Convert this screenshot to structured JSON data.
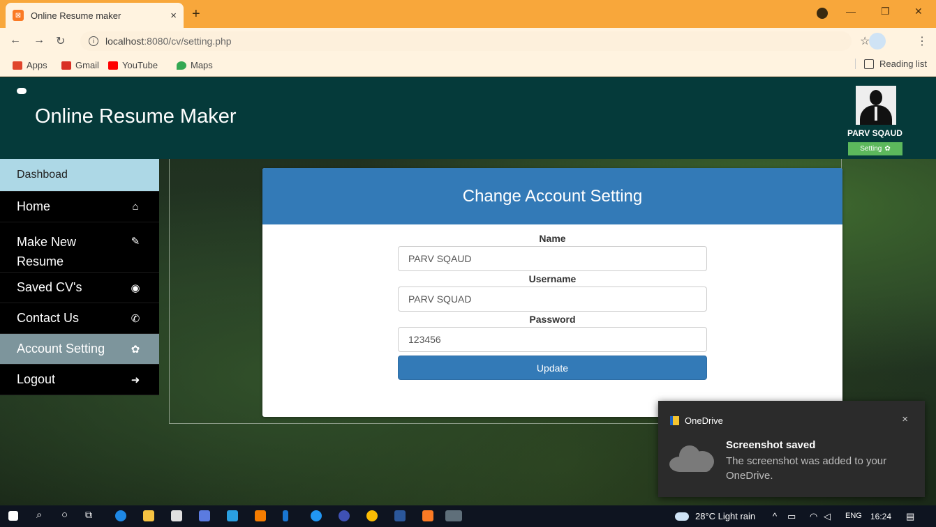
{
  "browser": {
    "tab_title": "Online Resume maker",
    "tab_close": "×",
    "new_tab": "+",
    "url_host": "localhost",
    "url_rest": ":8080/cv/setting.php",
    "bookmarks": [
      {
        "label": "Apps",
        "icon": "apps-grid-icon",
        "color": "#e0452c"
      },
      {
        "label": "Gmail",
        "icon": "gmail-icon",
        "color": "#d93025"
      },
      {
        "label": "YouTube",
        "icon": "youtube-icon",
        "color": "#ff0000"
      },
      {
        "label": "Maps",
        "icon": "maps-icon",
        "color": "#34a853"
      }
    ],
    "reading_list": "Reading list"
  },
  "site": {
    "title": "Online Resume Maker",
    "profile_name": "PARV SQAUD",
    "setting_button": "Setting"
  },
  "sidebar": {
    "items": [
      {
        "label": "Dashboad",
        "icon": ""
      },
      {
        "label": "Home",
        "icon": "home-icon"
      },
      {
        "label": "Make New Resume",
        "icon": "edit-icon"
      },
      {
        "label": "Saved CV's",
        "icon": "user-circle-icon"
      },
      {
        "label": "Contact Us",
        "icon": "phone-icon"
      },
      {
        "label": "Account Setting",
        "icon": "gear-icon"
      },
      {
        "label": "Logout",
        "icon": "logout-icon"
      }
    ]
  },
  "form": {
    "title": "Change Account Setting",
    "name_label": "Name",
    "name_value": "PARV SQAUD",
    "username_label": "Username",
    "username_value": "PARV SQUAD",
    "password_label": "Password",
    "password_value": "123456",
    "update_button": "Update"
  },
  "toast": {
    "app": "OneDrive",
    "title": "Screenshot saved",
    "message": "The screenshot was added to your OneDrive.",
    "close": "×"
  },
  "taskbar": {
    "weather": "28°C  Light rain",
    "language": "ENG",
    "time": "16:24"
  },
  "colors": {
    "header_bg": "#053a3a",
    "card_head": "#337ab7",
    "active_item": "#7d959c",
    "dash_item": "#add8e6"
  }
}
